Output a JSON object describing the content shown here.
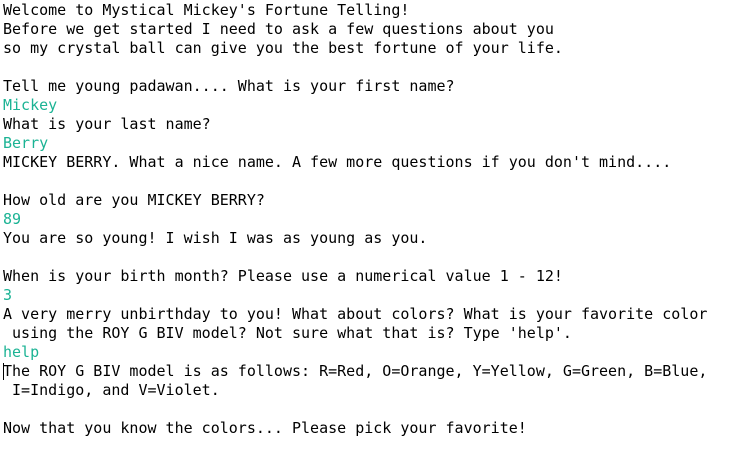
{
  "console": {
    "lines": [
      {
        "text": "Welcome to Mystical Mickey's Fortune Telling!",
        "kind": "output"
      },
      {
        "text": "Before we get started I need to ask a few questions about you",
        "kind": "output"
      },
      {
        "text": "so my crystal ball can give you the best fortune of your life.",
        "kind": "output"
      },
      {
        "text": "",
        "kind": "output"
      },
      {
        "text": "Tell me young padawan.... What is your first name?",
        "kind": "output"
      },
      {
        "text": "Mickey",
        "kind": "input"
      },
      {
        "text": "What is your last name?",
        "kind": "output"
      },
      {
        "text": "Berry",
        "kind": "input"
      },
      {
        "text": "MICKEY BERRY. What a nice name. A few more questions if you don't mind....",
        "kind": "output"
      },
      {
        "text": "",
        "kind": "output"
      },
      {
        "text": "How old are you MICKEY BERRY?",
        "kind": "output"
      },
      {
        "text": "89",
        "kind": "input"
      },
      {
        "text": "You are so young! I wish I was as young as you.",
        "kind": "output"
      },
      {
        "text": "",
        "kind": "output"
      },
      {
        "text": "When is your birth month? Please use a numerical value 1 - 12!",
        "kind": "output"
      },
      {
        "text": "3",
        "kind": "input"
      },
      {
        "text": "A very merry unbirthday to you! What about colors? What is your favorite color",
        "kind": "output"
      },
      {
        "text": " using the ROY G BIV model? Not sure what that is? Type 'help'.",
        "kind": "output"
      },
      {
        "text": "help",
        "kind": "input"
      },
      {
        "text": "The ROY G BIV model is as follows: R=Red, O=Orange, Y=Yellow, G=Green, B=Blue,",
        "kind": "output",
        "caret": true
      },
      {
        "text": " I=Indigo, and V=Violet.",
        "kind": "output"
      },
      {
        "text": "",
        "kind": "output"
      },
      {
        "text": "Now that you know the colors... Please pick your favorite!",
        "kind": "output"
      }
    ]
  },
  "colors": {
    "background": "#ffffff",
    "output_text": "#000000",
    "input_text": "#1bb394"
  }
}
